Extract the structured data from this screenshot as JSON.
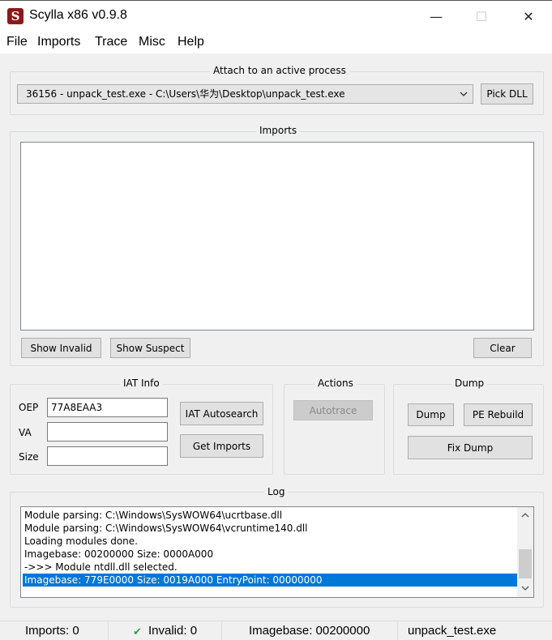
{
  "window": {
    "title": "Scylla x86 v0.9.8",
    "icon_glyph": "S",
    "minimize_glyph": "—",
    "maximize_glyph": "☐",
    "close_glyph": "✕"
  },
  "menu": [
    "File",
    "Imports",
    "Trace",
    "Misc",
    "Help"
  ],
  "attach": {
    "label": "Attach to an active process",
    "process_value": "36156 - unpack_test.exe - C:\\Users\\华为\\Desktop\\unpack_test.exe",
    "pick_dll_label": "Pick DLL"
  },
  "imports": {
    "label": "Imports",
    "show_invalid_label": "Show Invalid",
    "show_suspect_label": "Show Suspect",
    "clear_label": "Clear"
  },
  "iat_info": {
    "label": "IAT Info",
    "oep_label": "OEP",
    "oep_value": "77A8EAA3",
    "va_label": "VA",
    "va_value": "",
    "size_label": "Size",
    "size_value": "",
    "iat_autosearch_label": "IAT Autosearch",
    "get_imports_label": "Get Imports"
  },
  "actions": {
    "label": "Actions",
    "autotrace_label": "Autotrace"
  },
  "dump": {
    "label": "Dump",
    "dump_label": "Dump",
    "pe_rebuild_label": "PE Rebuild",
    "fix_dump_label": "Fix Dump"
  },
  "log": {
    "label": "Log",
    "lines": [
      "Module parsing: C:\\Windows\\SysWOW64\\ucrtbase.dll",
      "Module parsing: C:\\Windows\\SysWOW64\\vcruntime140.dll",
      "Loading modules done.",
      "Imagebase: 00200000 Size: 0000A000",
      "->>> Module ntdll.dll selected.",
      "Imagebase: 779E0000 Size: 0019A000 EntryPoint: 00000000"
    ],
    "selected_index": 5
  },
  "status": {
    "imports": "Imports: 0",
    "invalid": "Invalid: 0",
    "imagebase": "Imagebase: 00200000",
    "module": "unpack_test.exe",
    "check_glyph": "✔"
  },
  "colors": {
    "selection": "#0078d7",
    "check": "#2e9e3e",
    "icon": "#8b1a1a"
  }
}
